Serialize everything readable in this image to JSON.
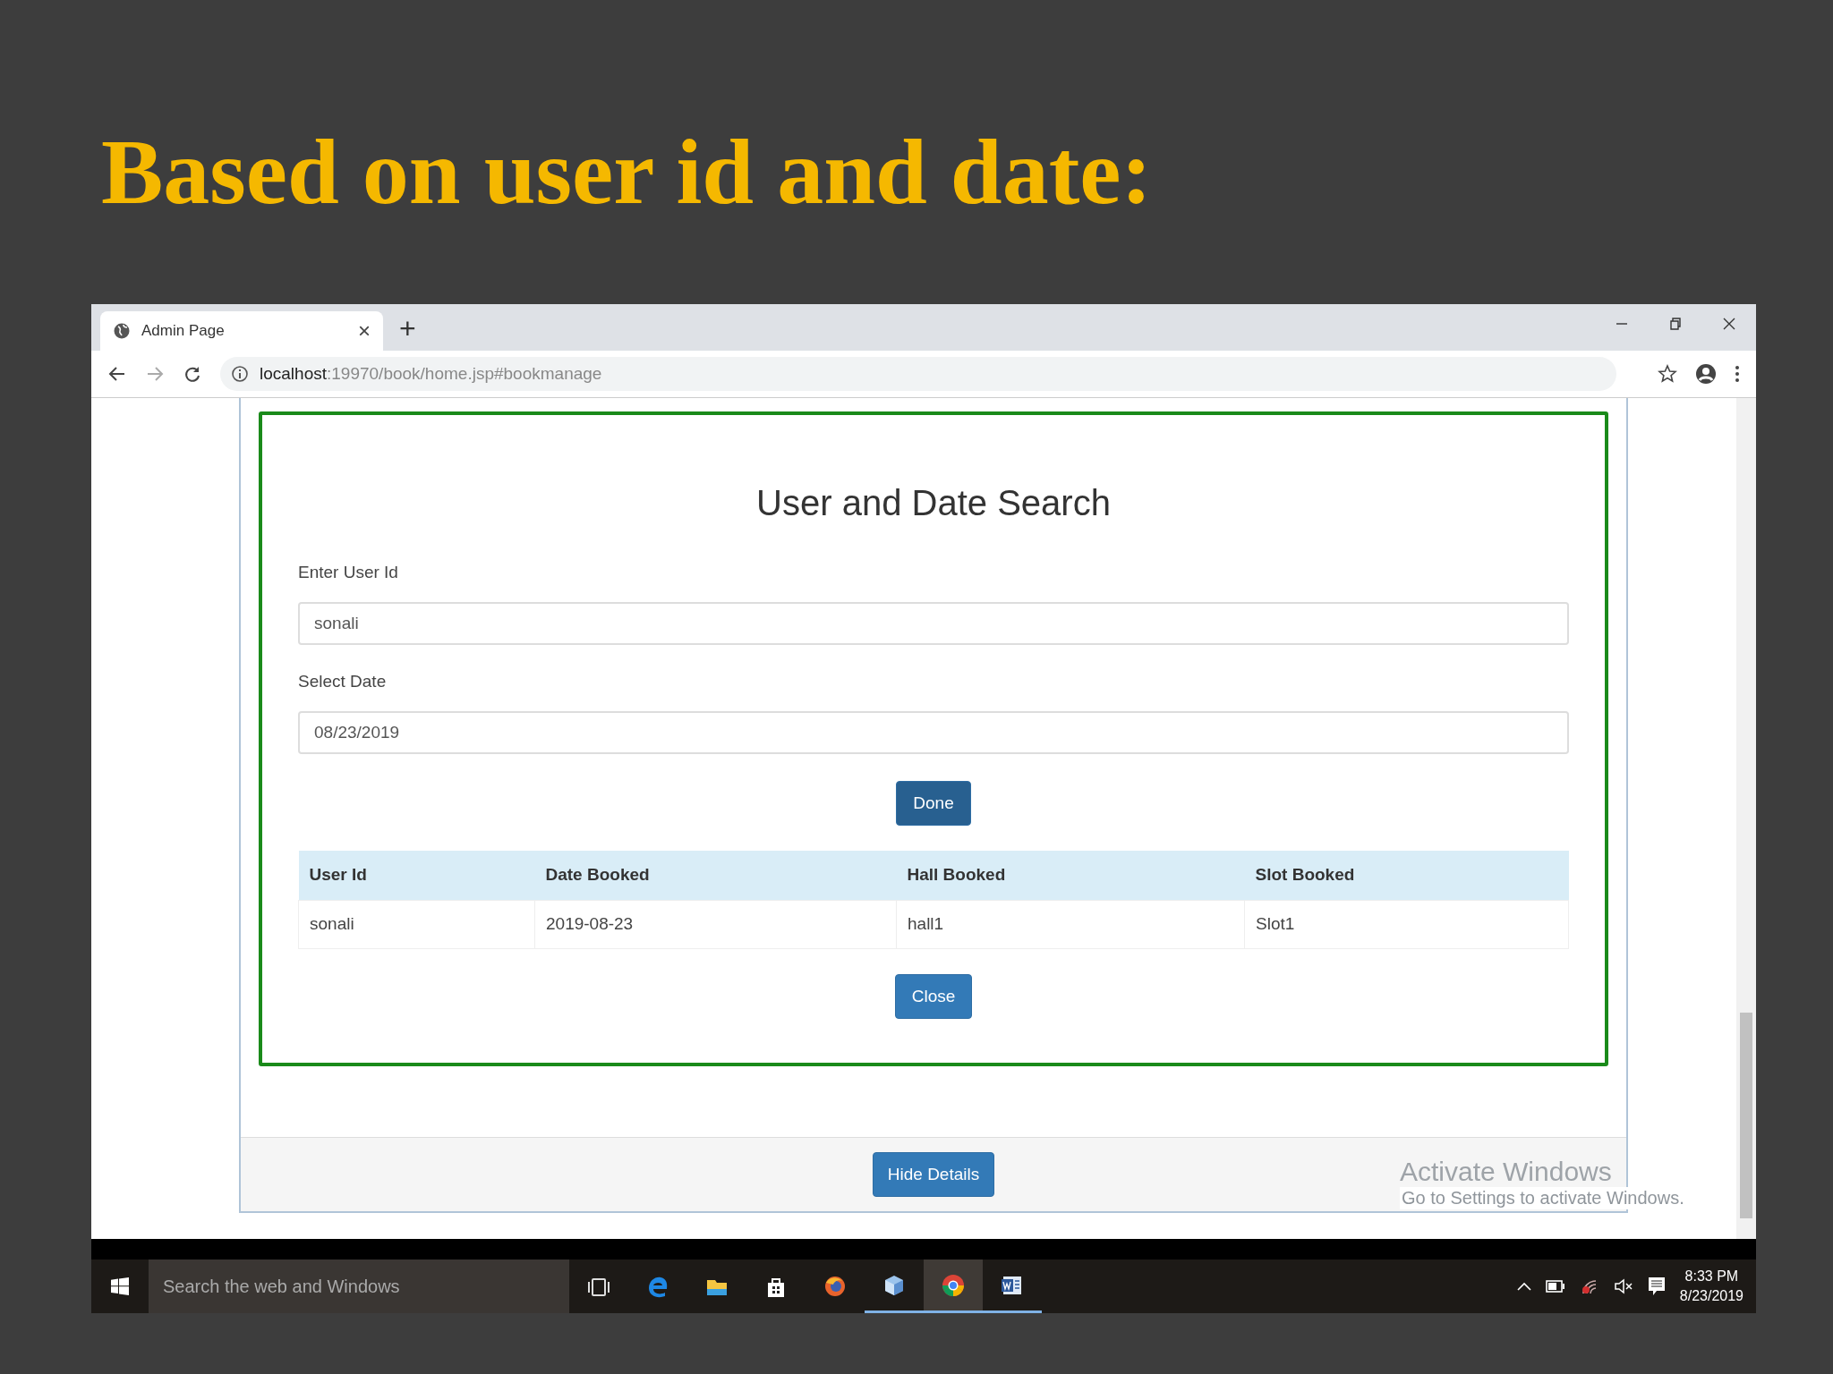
{
  "slide": {
    "title": "Based on user id and date:"
  },
  "browser": {
    "tab": {
      "title": "Admin Page",
      "close": "×",
      "new_tab": "+"
    },
    "url": {
      "host": "localhost",
      "path": ":19970/book/home.jsp#bookmanage"
    }
  },
  "form": {
    "heading": "User and Date Search",
    "fields": [
      {
        "label": "Enter User Id",
        "value": "sonali"
      },
      {
        "label": "Select Date",
        "value": "08/23/2019"
      }
    ],
    "submit": "Done",
    "table": {
      "columns": [
        "User Id",
        "Date Booked",
        "Hall Booked",
        "Slot Booked"
      ],
      "rows": [
        [
          "sonali",
          "2019-08-23",
          "hall1",
          "Slot1"
        ]
      ]
    },
    "close": "Close"
  },
  "footer": {
    "button": "Hide Details"
  },
  "activation": {
    "title": "Activate Windows",
    "text": "Go to Settings to activate Windows."
  },
  "taskbar": {
    "search": {
      "placeholder": "Search the web and Windows"
    },
    "apps": [
      {
        "kind": "taskview",
        "running": false,
        "selected": false
      },
      {
        "kind": "edge",
        "running": false,
        "selected": false
      },
      {
        "kind": "folder",
        "running": false,
        "selected": false
      },
      {
        "kind": "store",
        "running": false,
        "selected": false
      },
      {
        "kind": "firefox",
        "running": false,
        "selected": false
      },
      {
        "kind": "cube",
        "running": true,
        "selected": false
      },
      {
        "kind": "chrome",
        "running": true,
        "selected": true
      },
      {
        "kind": "word",
        "running": true,
        "selected": false
      }
    ],
    "time": "8:33 PM",
    "date": "8/23/2019"
  }
}
